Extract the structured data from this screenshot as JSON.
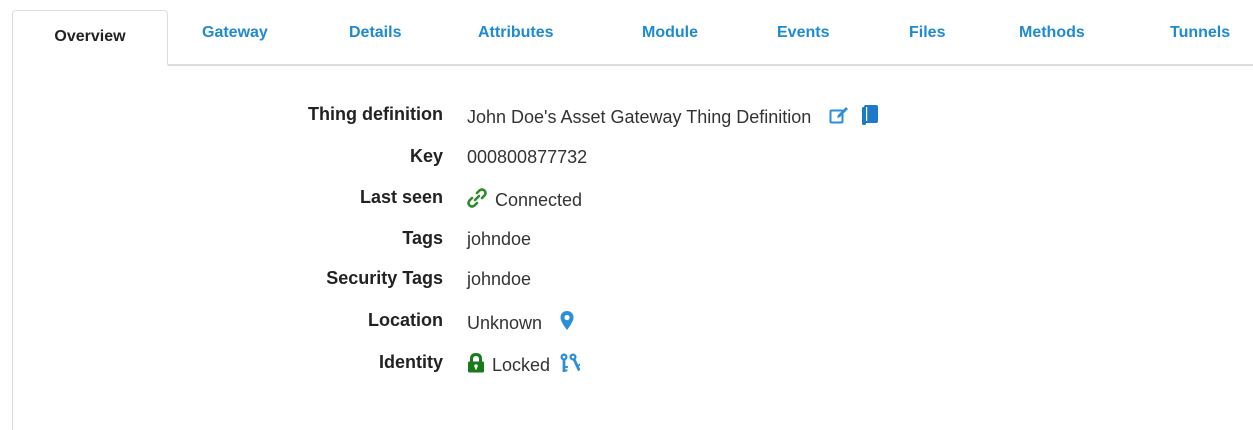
{
  "tabs": [
    {
      "label": "Overview",
      "active": true
    },
    {
      "label": "Gateway"
    },
    {
      "label": "Details"
    },
    {
      "label": "Attributes"
    },
    {
      "label": "Module"
    },
    {
      "label": "Events"
    },
    {
      "label": "Files"
    },
    {
      "label": "Methods"
    },
    {
      "label": "Tunnels"
    }
  ],
  "fields": {
    "thing_definition": {
      "label": "Thing definition",
      "value": "John Doe's Asset Gateway Thing Definition"
    },
    "key": {
      "label": "Key",
      "value": "000800877732"
    },
    "last_seen": {
      "label": "Last seen",
      "value": "Connected"
    },
    "tags": {
      "label": "Tags",
      "value": "johndoe"
    },
    "security_tags": {
      "label": "Security Tags",
      "value": "johndoe"
    },
    "location": {
      "label": "Location",
      "value": "Unknown"
    },
    "identity": {
      "label": "Identity",
      "value": "Locked"
    }
  },
  "icons": {
    "edit": "edit-icon",
    "copy": "copy-icon",
    "link": "link-icon",
    "map_marker": "map-marker-icon",
    "lock": "lock-icon",
    "keys": "keys-icon"
  },
  "colors": {
    "tab_link": "#1e8ad2",
    "connected_green": "#2e8b2e",
    "icon_blue": "#2a8fd8",
    "lock_green": "#1a7a1a"
  }
}
